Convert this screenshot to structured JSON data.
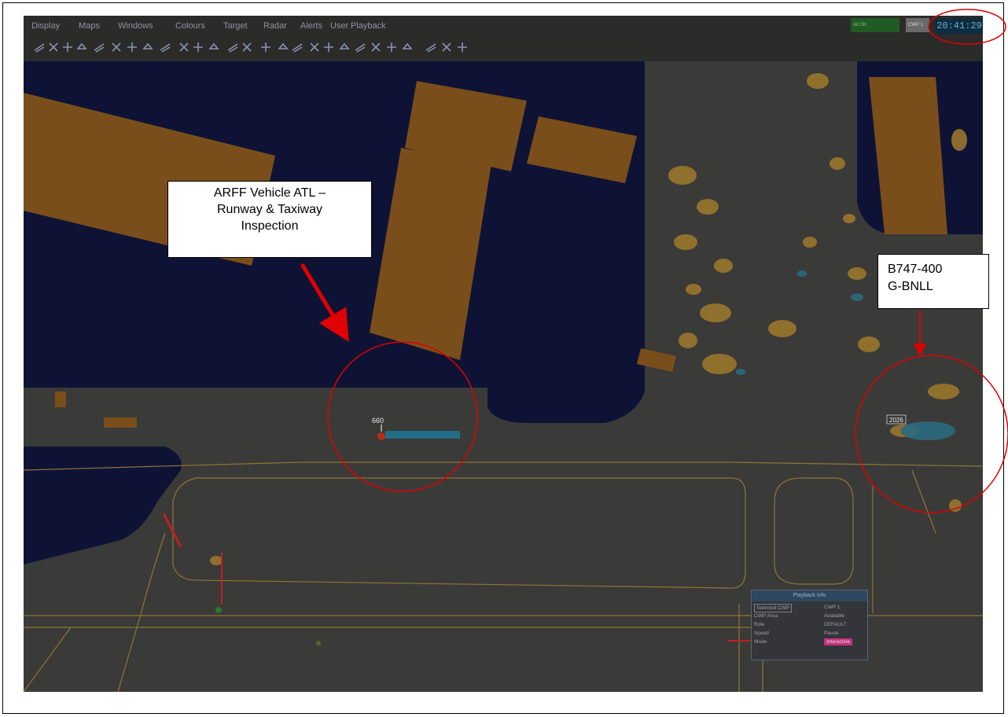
{
  "menu": [
    "Display",
    "Maps",
    "Windows",
    "Colours",
    "Target",
    "Radar",
    "Alerts",
    "User",
    "Playback"
  ],
  "status": {
    "indicator_1": "All OK",
    "indicator_2": "CWP 1",
    "clock": "20:41:29"
  },
  "toolbar_icons": [
    "runway-icon",
    "scale-icon",
    "taxiway-icon",
    "aircraft-icon",
    "map-layer-icon",
    "vehicle-icon",
    "vehicle-alt-icon",
    "label-icon",
    "track-icon",
    "history-icon",
    "filter-icon",
    "range-icon",
    "zoom-icon",
    "globe-icon",
    "rotate-icon",
    "measure-icon",
    "bearing-icon",
    "route-icon",
    "check-icon",
    "lock-icon",
    "pointer-icon",
    "target-icon",
    "person-icon",
    "people-icon",
    "arrow-icon",
    "flag-icon",
    "flag-alt-icon"
  ],
  "map": {
    "vehicle_label": "660",
    "aircraft_label": "2026"
  },
  "playback_info": {
    "title": "Playback Info",
    "rows": [
      {
        "label": "Selected CWP",
        "value": "CWP 1"
      },
      {
        "label": "CWP Area",
        "value": "Available"
      },
      {
        "label": "Role",
        "value": "DEFAULT"
      },
      {
        "label": "Speed",
        "value": "Pause"
      },
      {
        "label": "Mode",
        "value": "Interactive"
      }
    ]
  },
  "callouts": {
    "arff": {
      "line1": "ARFF Vehicle ATL –",
      "line2": "Runway & Taxiway",
      "line3": "Inspection"
    },
    "b747": {
      "line1": "B747-400",
      "line2": "G-BNLL"
    }
  },
  "colors": {
    "apron": "#3a3a38",
    "grass": "#0e1336",
    "building": "#7a4e1a",
    "taxi_line": "#8f7636",
    "annotation": "#e10000",
    "playback_mode": "#c0347e"
  }
}
